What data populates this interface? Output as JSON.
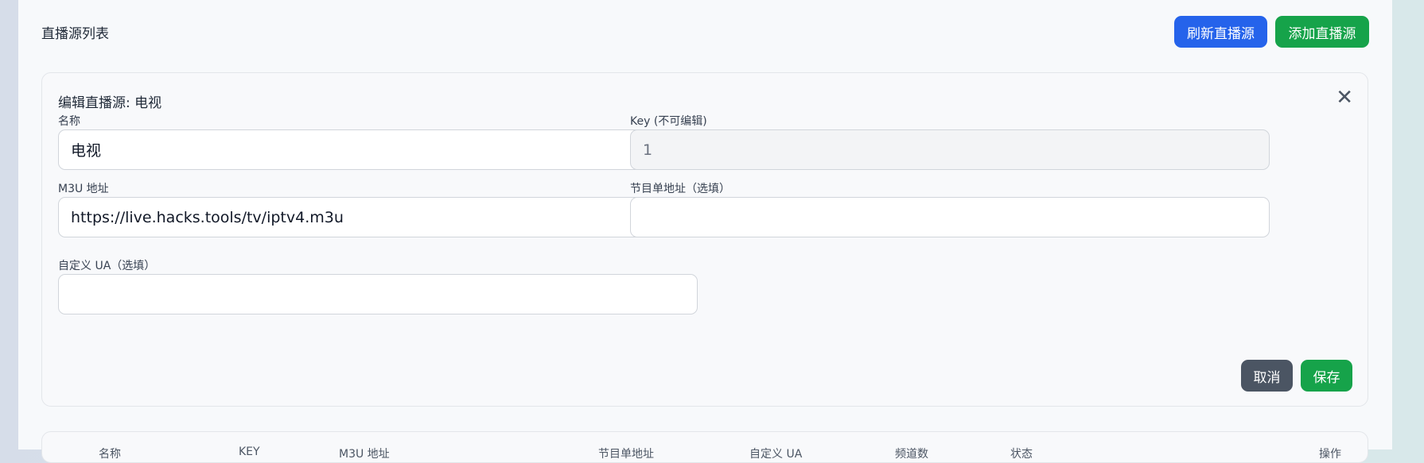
{
  "header": {
    "title": "直播源列表",
    "refresh_label": "刷新直播源",
    "add_label": "添加直播源"
  },
  "edit": {
    "title": "编辑直播源: 电视",
    "name_label": "名称",
    "name_value": "电视",
    "key_label": "Key (不可编辑)",
    "key_value": "1",
    "m3u_label": "M3U 地址",
    "m3u_value": "https://live.hacks.tools/tv/iptv4.m3u",
    "epg_label": "节目单地址（选填）",
    "epg_value": "",
    "ua_label": "自定义 UA（选填）",
    "ua_value": "",
    "cancel_label": "取消",
    "save_label": "保存"
  },
  "table": {
    "headers": [
      "名称",
      "KEY",
      "M3U 地址",
      "节目单地址",
      "自定义 UA",
      "频道数",
      "状态",
      "操作"
    ]
  }
}
